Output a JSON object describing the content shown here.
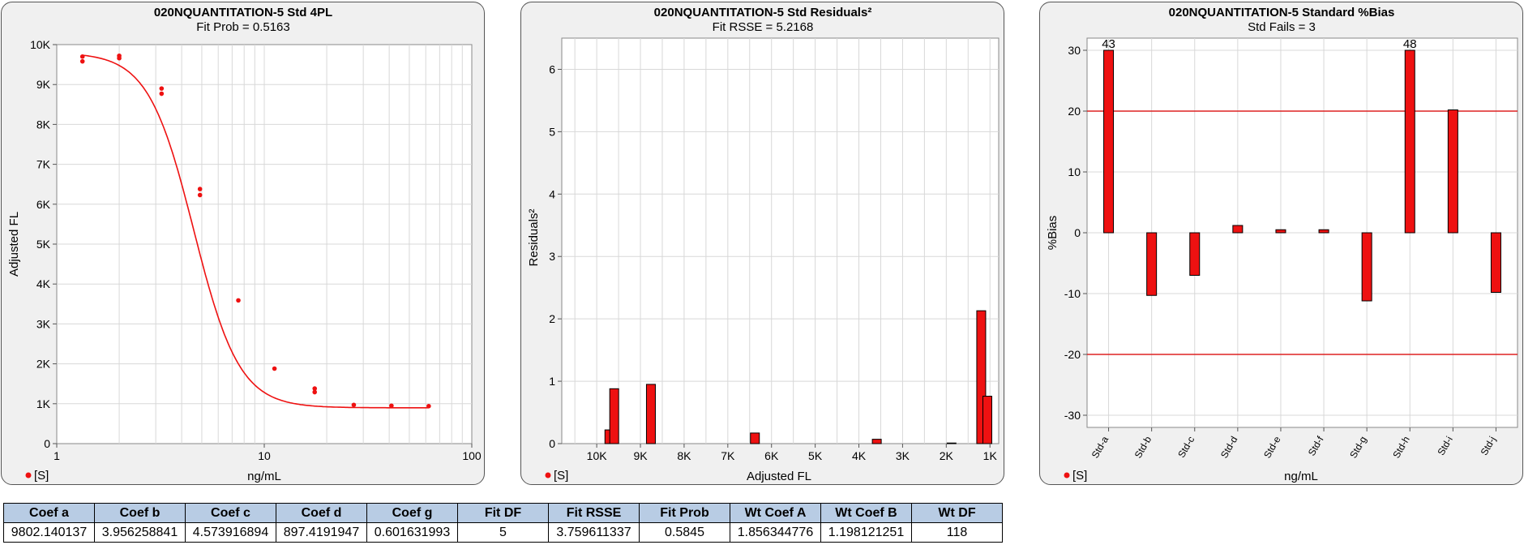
{
  "colors": {
    "series": "#ee1111",
    "limit_line": "#dd2222",
    "grid": "#d8d8d8",
    "plot_bg": "#ffffff",
    "panel_bg": "#f0f0f0",
    "table_header": "#b8cce4"
  },
  "chart_data": [
    {
      "type": "scatter",
      "title": "020NQUANTITATION-5 Std 4PL",
      "subtitle": "Fit Prob = 0.5163",
      "xlabel": "ng/mL",
      "ylabel": "Adjusted FL",
      "xscale": "log",
      "xlim": [
        1,
        100
      ],
      "ylim": [
        0,
        10000
      ],
      "x_tick_labels": [
        "1",
        "10",
        "100"
      ],
      "y_tick_labels": [
        "0",
        "1K",
        "2K",
        "3K",
        "4K",
        "5K",
        "6K",
        "7K",
        "8K",
        "9K",
        "10K"
      ],
      "legend": "[S]",
      "legend_position": "bottom-left",
      "grid": true,
      "points": [
        {
          "x": 1.33,
          "y": 9700
        },
        {
          "x": 1.33,
          "y": 9580
        },
        {
          "x": 2.0,
          "y": 9720
        },
        {
          "x": 2.0,
          "y": 9660
        },
        {
          "x": 3.2,
          "y": 8900
        },
        {
          "x": 3.2,
          "y": 8770
        },
        {
          "x": 4.9,
          "y": 6380
        },
        {
          "x": 4.9,
          "y": 6230
        },
        {
          "x": 7.5,
          "y": 3590
        },
        {
          "x": 11.2,
          "y": 1880
        },
        {
          "x": 17.5,
          "y": 1380
        },
        {
          "x": 17.5,
          "y": 1290
        },
        {
          "x": 27.0,
          "y": 970
        },
        {
          "x": 41.0,
          "y": 950
        },
        {
          "x": 62.0,
          "y": 940
        }
      ],
      "fit": {
        "model": "4PL",
        "a": 9802.140137,
        "b": 3.956258841,
        "c": 4.573916894,
        "d": 897.4191947,
        "x_range": [
          1.33,
          62
        ]
      }
    },
    {
      "type": "bar",
      "title": "020NQUANTITATION-5 Std  Residuals²",
      "subtitle": "Fit RSSE = 5.2168",
      "xlabel": "Adjusted FL",
      "ylabel": "Residuals²",
      "xlim": [
        10800,
        800
      ],
      "ylim": [
        0,
        6.5
      ],
      "x_tick_labels": [
        "10K",
        "9K",
        "8K",
        "7K",
        "6K",
        "5K",
        "4K",
        "3K",
        "2K",
        "1K"
      ],
      "y_tick_labels": [
        "0",
        "1",
        "2",
        "3",
        "4",
        "5",
        "6"
      ],
      "legend": "[S]",
      "legend_position": "bottom-left",
      "grid": true,
      "bars": [
        {
          "x": 9710,
          "y": 0.22
        },
        {
          "x": 9600,
          "y": 0.88
        },
        {
          "x": 8760,
          "y": 0.95
        },
        {
          "x": 6380,
          "y": 0.17
        },
        {
          "x": 3590,
          "y": 0.07
        },
        {
          "x": 1880,
          "y": 0.01
        },
        {
          "x": 1200,
          "y": 2.13
        },
        {
          "x": 1060,
          "y": 0.76
        }
      ]
    },
    {
      "type": "bar",
      "title": "020NQUANTITATION-5 Standard %Bias",
      "subtitle": "Std Fails = 3",
      "xlabel": "ng/mL",
      "ylabel": "%Bias",
      "ylim": [
        -32,
        32
      ],
      "y_tick_labels": [
        "30",
        "20",
        "10",
        "0",
        "-10",
        "-20",
        "-30"
      ],
      "categories": [
        "Std-a",
        "Std-b",
        "Std-c",
        "Std-d",
        "Std-e",
        "Std-f",
        "Std-g",
        "Std-h",
        "Std-i",
        "Std-j"
      ],
      "values": [
        43,
        -10.3,
        -7.0,
        1.2,
        0.5,
        0.5,
        -11.2,
        48,
        20.2,
        -9.8
      ],
      "clipped_labels": [
        "43",
        "",
        "",
        "",
        "",
        "",
        "",
        "48",
        "",
        ""
      ],
      "limits": [
        20,
        -20
      ],
      "legend": "[S]",
      "legend_position": "bottom-left",
      "grid": true
    }
  ],
  "table": {
    "headers": [
      "Coef a",
      "Coef b",
      "Coef c",
      "Coef d",
      "Coef g",
      "Fit DF",
      "Fit RSSE",
      "Fit Prob",
      "Wt Coef A",
      "Wt Coef B",
      "Wt DF"
    ],
    "rows": [
      [
        "9802.140137",
        "3.956258841",
        "4.573916894",
        "897.4191947",
        "0.601631993",
        "5",
        "3.759611337",
        "0.5845",
        "1.856344776",
        "1.198121251",
        "118"
      ]
    ]
  }
}
